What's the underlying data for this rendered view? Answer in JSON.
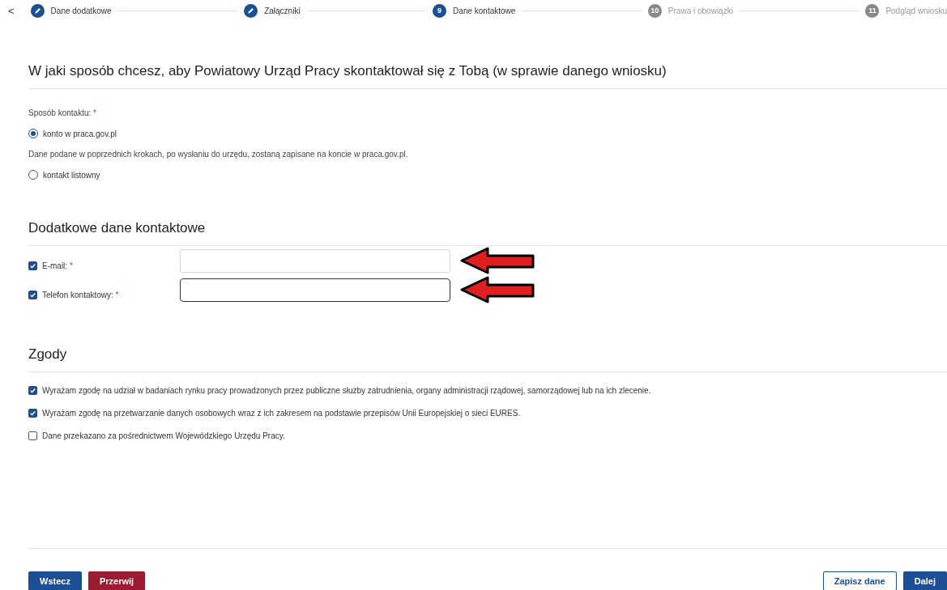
{
  "stepper": {
    "back": "<",
    "steps": [
      {
        "label": "Dane dodatkowe",
        "kind": "done"
      },
      {
        "label": "Załączniki",
        "kind": "done"
      },
      {
        "label": "Dane kontaktowe",
        "kind": "current",
        "number": "9"
      },
      {
        "label": "Prawa i obowiązki",
        "kind": "pending",
        "number": "10"
      },
      {
        "label": "Podgląd wniosku",
        "kind": "pending",
        "number": "11"
      }
    ]
  },
  "contact": {
    "title": "W jaki sposób chcesz, aby Powiatowy Urząd Pracy skontaktował się z Tobą (w sprawie danego wniosku)",
    "field_label": "Sposób kontaktu:",
    "required": "*",
    "options": [
      {
        "label": "konto w praca.gov.pl",
        "selected": true,
        "note": "Dane podane w poprzednich krokach, po wysłaniu do urzędu, zostaną zapisane na koncie w praca.gov.pl."
      },
      {
        "label": "kontakt listowny",
        "selected": false
      }
    ]
  },
  "extra": {
    "title": "Dodatkowe dane kontaktowe",
    "fields": [
      {
        "label": "E-mail:",
        "required": "*",
        "checked": true,
        "focused": false
      },
      {
        "label": "Telefon kontaktowy:",
        "required": "*",
        "checked": true,
        "focused": true
      }
    ]
  },
  "consents": {
    "title": "Zgody",
    "items": [
      {
        "label": "Wyrażam zgodę na udział w badaniach rynku pracy prowadzonych przez publiczne służby zatrudnienia, organy administracji rządowej, samorządowej lub na ich zlecenie.",
        "checked": true
      },
      {
        "label": "Wyrażam zgodę na przetwarzanie danych osobowych wraz z ich zakresem na podstawie przepisów Unii Europejskiej o sieci EURES.",
        "checked": true
      },
      {
        "label": "Dane przekazano za pośrednictwem Wojewódzkiego Urzędu Pracy.",
        "checked": false
      }
    ]
  },
  "footer": {
    "left": [
      {
        "label": "Wstecz",
        "kind": "primary"
      },
      {
        "label": "Przerwij",
        "kind": "danger"
      }
    ],
    "right": [
      {
        "label": "Zapisz dane",
        "kind": "outline"
      },
      {
        "label": "Dalej",
        "kind": "primary"
      }
    ]
  }
}
